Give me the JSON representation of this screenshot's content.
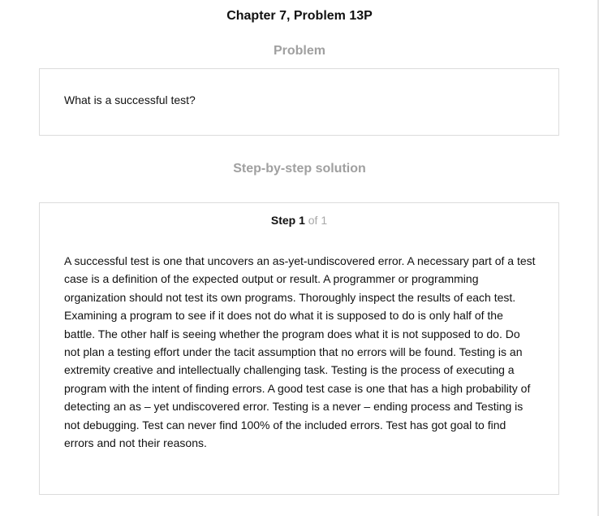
{
  "chapter_title": "Chapter 7, Problem 13P",
  "problem": {
    "heading": "Problem",
    "text": "What is a successful test?"
  },
  "solution": {
    "heading": "Step-by-step solution",
    "step_word": "Step 1",
    "step_of": "of 1",
    "text": "A successful test is one that uncovers an as-yet-undiscovered error. A necessary part of a test case is a definition of the expected output or result. A programmer or programming organization should not test its own programs. Thoroughly inspect the results of each test. Examining a program to see if it does not do what it is supposed to do is only half of the battle. The other half is seeing whether the program does what it is not supposed to do. Do not plan a testing effort under the tacit assumption that no errors will be found. Testing is an extremity creative and intellectually challenging task. Testing is the process of executing a program with the intent of finding errors. A good test case is one that has a high probability of detecting an as – yet undiscovered error. Testing is a never – ending process and Testing is not debugging. Test can never find 100% of the included errors. Test has got goal to find errors and not their reasons."
  }
}
